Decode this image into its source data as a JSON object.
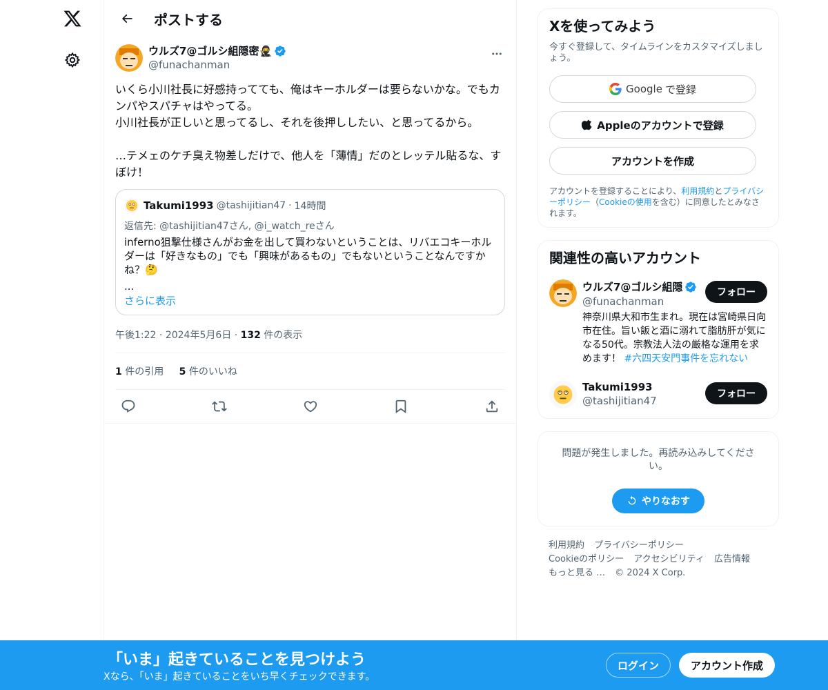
{
  "nav": {
    "logo_icon": "x-logo-icon",
    "settings_icon": "gear-icon"
  },
  "header": {
    "title": "ポストする",
    "back_icon": "arrow-left-icon"
  },
  "tweet": {
    "author_name": "ウルズ7@ゴルシ組隠密🥷",
    "author_handle": "@funachanman",
    "body": "いくら小川社長に好感持ってても、俺はキーホルダーは要らないかな。でもカンパやスパチャはやってる。\n小川社長が正しいと思ってるし、それを後押ししたい、と思ってるから。\n\n…テメェのケチ臭え物差しだけで、他人を「薄情」だのとレッテル貼るな、すぼけ！",
    "quote": {
      "name": "Takumi1993",
      "handle": "@tashijitian47",
      "dot": "·",
      "time": "14時間",
      "reply_to": "返信先: @tashijitian47さん, @i_watch_reさん",
      "text": "inferno狙撃仕様さんがお金を出して買わないということは、リバエコキーホルダーは「好きなもの」でも「興味があるもの」でもないということなんですかね？🤔",
      "ellipsis": "...",
      "show_more": "さらに表示"
    },
    "time": "午後1:22",
    "date": "2024年5月6日",
    "views_count": "132",
    "views_label": "件の表示",
    "quotes_count": "1",
    "quotes_label": "件の引用",
    "likes_count": "5",
    "likes_label": "件のいいね",
    "actions": [
      "reply-icon",
      "retweet-icon",
      "like-icon",
      "bookmark-icon",
      "share-icon"
    ]
  },
  "signup": {
    "title": "Xを使ってみよう",
    "subtitle": "今すぐ登録して、タイムラインをカスタマイズしましょう。",
    "google_brand": "Google",
    "google_suffix": "で登録",
    "apple_label": "Appleのアカウントで登録",
    "create_label": "アカウントを作成",
    "terms_1": "アカウントを登録することにより、",
    "terms_link1": "利用規約",
    "terms_2": "と",
    "terms_link2": "プライバシーポリシー",
    "terms_3": "（",
    "terms_link3": "Cookieの使用",
    "terms_4": "を含む）に同意したとみなされます。"
  },
  "related": {
    "title": "関連性の高いアカウント",
    "accounts": [
      {
        "name": "ウルズ7@ゴルシ組隠",
        "handle": "@funachanman",
        "bio": "神奈川県大和市生まれ。現在は宮崎県日向市在住。旨い飯と酒に溺れて脂肪肝が気になる50代。宗教法人法の厳格な運用を求めます！",
        "hashtag": "#六四天安門事件を忘れない",
        "follow": "フォロー"
      },
      {
        "name": "Takumi1993",
        "handle": "@tashijitian47",
        "follow": "フォロー"
      }
    ]
  },
  "error_card": {
    "message": "問題が発生しました。再読み込みしてください。",
    "retry": "やりなおす"
  },
  "footer": {
    "links": [
      "利用規約",
      "プライバシーポリシー",
      "Cookieのポリシー",
      "アクセシビリティ",
      "広告情報",
      "もっと見る …",
      "© 2024 X Corp."
    ]
  },
  "bottom_bar": {
    "title": "「いま」起きていることを見つけよう",
    "subtitle": "Xなら、「いま」起きていることをいち早くチェックできます。",
    "login": "ログイン",
    "signup": "アカウント作成"
  },
  "colors": {
    "accent": "#1d9bf0",
    "text": "#0f1419",
    "muted": "#536471",
    "border": "#eff3f4"
  }
}
